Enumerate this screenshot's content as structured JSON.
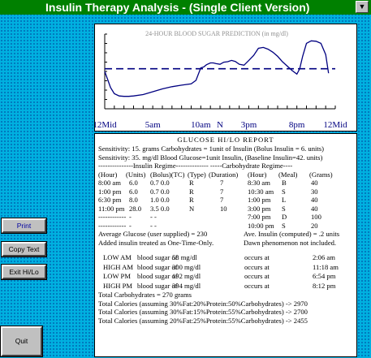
{
  "window": {
    "title": "Insulin Therapy Analysis - (Single Client Version)",
    "dropdown_glyph": "▼"
  },
  "chart_data": {
    "type": "line",
    "title": "24-HOUR BLOOD SUGAR PREDICTION (in mg/dl)",
    "x_tick_labels": [
      "12Mid",
      "5am",
      "10am",
      "N",
      "3pm",
      "8pm",
      "12Mid"
    ],
    "x_tick_hours": [
      0,
      5,
      10,
      12,
      15,
      20,
      24
    ],
    "xlim": [
      0,
      24
    ],
    "ylim": [
      0,
      420
    ],
    "reference_line": {
      "value": 225,
      "style": "dashed"
    },
    "series": [
      {
        "x": [
          0,
          0.3,
          0.6,
          1,
          1.5,
          2,
          2.5,
          3,
          4,
          5,
          6,
          7,
          8,
          9,
          9.5,
          10,
          10.3,
          10.6,
          11,
          11.3,
          11.6,
          12,
          12.4,
          12.8,
          13.2,
          13.6,
          14,
          14.5,
          15,
          15.5,
          16,
          16.5,
          17,
          17.5,
          18,
          18.5,
          19,
          19.5,
          20,
          20.3,
          20.6,
          21,
          21.5,
          22,
          22.5,
          23,
          23.3
        ],
        "y": [
          210,
          165,
          120,
          85,
          72,
          70,
          70,
          72,
          80,
          96,
          112,
          124,
          133,
          140,
          160,
          230,
          235,
          248,
          258,
          258,
          254,
          250,
          262,
          265,
          272,
          266,
          250,
          245,
          272,
          300,
          340,
          345,
          335,
          318,
          295,
          265,
          240,
          215,
          195,
          225,
          295,
          368,
          382,
          380,
          368,
          305,
          200
        ]
      }
    ]
  },
  "report": {
    "title": "GLUCOSE HI/LO REPORT",
    "sensitivity_carb": "Sensitivity: 15. grams Carbohydrates = 1unit of Insulin (Bolus Insulin = 6. units)",
    "sensitivity_bg": "Sensitivity: 35. mg/dl Blood Glucose=1unit Insulin, (Baseline Insulin=42. units)",
    "regime_header": "---------------Insulin Regime-------------- -----Carbohydrate Regime----",
    "col_headers": [
      "(Hour)",
      "(Units)",
      "(Bolus)(TC)",
      "(Type)",
      "(Duration)",
      "(Hour)",
      "(Meal)",
      "(Grams)"
    ],
    "rows": [
      [
        "8:00 am",
        "6.0",
        "0.7  0.0",
        "R",
        "7",
        "8:30 am",
        "B",
        "40"
      ],
      [
        "1:00 pm",
        "6.0",
        "0.7  0.0",
        "R",
        "7",
        "10:30 am",
        "S",
        "30"
      ],
      [
        "6:30 pm",
        "8.0",
        "1.0  0.0",
        "R",
        "7",
        "1:00 pm",
        "L",
        "40"
      ],
      [
        "11:00 pm",
        "28.0",
        "3.5  0.0",
        "N",
        "10",
        "3:00 pm",
        "S",
        "40"
      ],
      [
        "------------",
        "-",
        "-     -",
        "",
        "",
        "7:00 pm",
        "D",
        "100"
      ],
      [
        "------------",
        "-",
        "-     -",
        "",
        "",
        "10:00 pm",
        "S",
        "20"
      ]
    ],
    "avg_glucose": "Average Glucose (user supplied) = 230",
    "avg_insulin": "Ave. Insulin (computed) = .2 units",
    "added_insulin": "Added insulin treated as One-Time-Only.",
    "dawn": "Dawn phenomenon not included.",
    "extremes": [
      {
        "label": "LOW AM",
        "desc": "blood sugar of",
        "value": "58 mg/dl",
        "occurs": "occurs at",
        "time": "2:06 am"
      },
      {
        "label": "HIGH AM",
        "desc": "blood sugar of",
        "value": "300 mg/dl",
        "occurs": "occurs at",
        "time": "11:18 am"
      },
      {
        "label": "LOW PM",
        "desc": "blood sugar of",
        "value": "192 mg/dl",
        "occurs": "occurs at",
        "time": "6:54 pm"
      },
      {
        "label": "HIGH PM",
        "desc": "blood sugar of",
        "value": "394 mg/dl",
        "occurs": "occurs at",
        "time": "8:12 pm"
      }
    ],
    "total_carbs": "Total Carbohydrates = 270 grams",
    "calories": [
      "Total Calories (assuming 30%Fat:20%Protein:50%Carbohydrates) -> 2970",
      "Total Calories (assuming 30%Fat:15%Protein:55%Carbohydrates) -> 2700",
      "Total Calories (assuming 20%Fat:25%Protein:55%Carbohydrates) -> 2455"
    ]
  },
  "buttons": {
    "print": "Print",
    "copy": "Copy Text",
    "exit": "Exit Hi/Lo",
    "quit": "Quit"
  },
  "colors": {
    "title_bar": "#008000",
    "background": "#00b0e0",
    "curve": "#000080"
  }
}
